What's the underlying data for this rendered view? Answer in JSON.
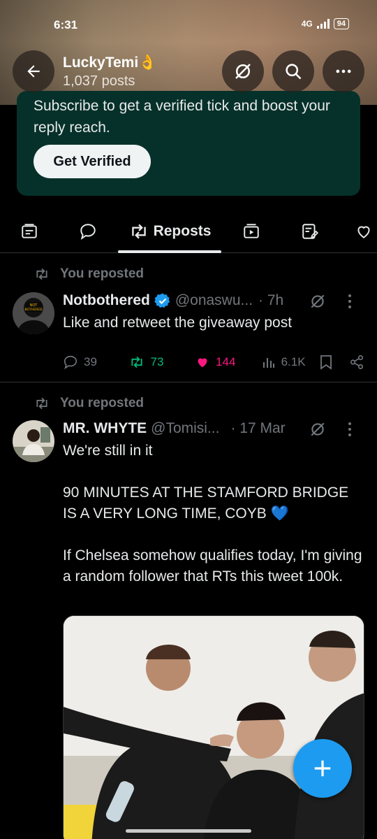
{
  "status": {
    "time": "6:31",
    "network": "4G",
    "battery": "94"
  },
  "profile": {
    "name": "LuckyTemi👌",
    "posts": "1,037 posts"
  },
  "verify": {
    "text": "Subscribe to get a verified tick and boost your reply reach.",
    "button": "Get Verified"
  },
  "tabs": {
    "active_label": "Reposts"
  },
  "posts": [
    {
      "repost_label": "You reposted",
      "name": "Notbothered",
      "handle": "@onaswu...",
      "time": "· 7h",
      "text": "Like and retweet the giveaway post",
      "replies": "39",
      "reposts": "73",
      "likes": "144",
      "views": "6.1K"
    },
    {
      "repost_label": "You reposted",
      "name": "MR. WHYTE",
      "handle": "@Tomisi...",
      "time": "· 17 Mar",
      "text1": "We're still in it",
      "text2": "90 MINUTES AT THE STAMFORD BRIDGE IS A VERY LONG TIME, COYB 💙",
      "text3": "If Chelsea somehow qualifies today, I'm giving a random follower that RTs this tweet 100k."
    }
  ],
  "colors": {
    "accent": "#1d9bf0",
    "verified_card": "#06312a",
    "like": "#f91880",
    "repost": "#00ba7c"
  }
}
